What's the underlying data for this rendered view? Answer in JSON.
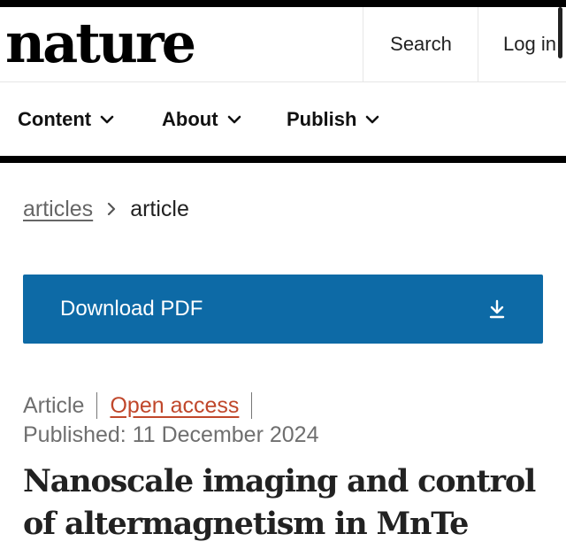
{
  "masthead": {
    "logo": "nature",
    "search_label": "Search",
    "login_label": "Log in"
  },
  "nav": {
    "items": [
      {
        "label": "Content"
      },
      {
        "label": "About"
      },
      {
        "label": "Publish"
      }
    ]
  },
  "breadcrumb": {
    "link": "articles",
    "current": "article"
  },
  "download": {
    "label": "Download PDF"
  },
  "article": {
    "type": "Article",
    "access": "Open access",
    "published": "Published: 11 December 2024",
    "title": "Nanoscale imaging and control of altermagnetism in MnTe"
  },
  "colors": {
    "download_button": "#0d6aa6",
    "open_access_link": "#c0472b"
  }
}
